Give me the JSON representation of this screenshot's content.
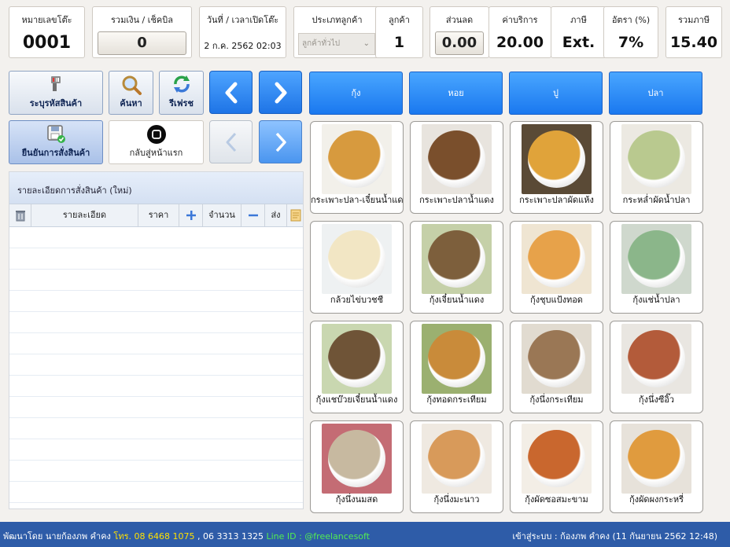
{
  "header": [
    {
      "label": "หมายเลขโต๊ะ",
      "value": "0001"
    },
    {
      "label": "รวมเงิน / เช็คบิล",
      "value": "0"
    },
    {
      "label": "วันที่ / เวลาเปิดโต๊ะ",
      "value": "2 ก.ค. 2562 02:03"
    },
    {
      "label": "ประเภทลูกค้า",
      "value": "ลูกค้าทั่วไป"
    },
    {
      "label": "ลูกค้า",
      "value": "1"
    },
    {
      "label": "ส่วนลด",
      "value": "0.00"
    },
    {
      "label": "ค่าบริการ",
      "value": "20.00"
    },
    {
      "label": "ภาษี",
      "value": "Ext."
    },
    {
      "label": "อัตรา (%)",
      "value": "7%"
    },
    {
      "label": "รวมภาษี",
      "value": "15.40"
    }
  ],
  "actions": {
    "barcode": "ระบุรหัสสินค้า",
    "search": "ค้นหา",
    "refresh": "รีเฟรช",
    "confirm": "ยืนยันการสั่งสินค้า",
    "home": "กลับสู่หน้าแรก"
  },
  "order": {
    "title": "รายละเอียดการสั่งสินค้า (ใหม่)",
    "columns": {
      "detail": "รายละเอียด",
      "price": "ราคา",
      "qty": "จำนวน",
      "send": "ส่ง"
    }
  },
  "categories": [
    "กุ้ง",
    "หอย",
    "ปู",
    "ปลา"
  ],
  "menu": [
    {
      "name": "กระเพาะปลา-เจี๋ยนน้ำแดง",
      "plate": "#d79a3e",
      "bg": "#f2f0ea"
    },
    {
      "name": "กระเพาะปลาน้ำแดง",
      "plate": "#7a4f2c",
      "bg": "#e8e4de"
    },
    {
      "name": "กระเพาะปลาผัดแห้ง",
      "plate": "#e0a33a",
      "bg": "#5a4a36"
    },
    {
      "name": "กระหล่ำผัดน้ำปลา",
      "plate": "#b9c98f",
      "bg": "#ece9e2"
    },
    {
      "name": "กล้วยไข่บวชชี",
      "plate": "#f2e6c4",
      "bg": "#eef1f2"
    },
    {
      "name": "กุ้งเจี๋ยนน้ำแดง",
      "plate": "#7d5f3c",
      "bg": "#c5d0a8"
    },
    {
      "name": "กุ้งชุบแป้งทอด",
      "plate": "#e7a24a",
      "bg": "#efe5d2"
    },
    {
      "name": "กุ้งแช่น้ำปลา",
      "plate": "#8bb68a",
      "bg": "#cfd8cd"
    },
    {
      "name": "กุ้งแชบ๊วยเจี๋ยนน้ำแดง",
      "plate": "#6f5437",
      "bg": "#c9d7b0"
    },
    {
      "name": "กุ้งทอดกระเทียม",
      "plate": "#c98b3a",
      "bg": "#9bb070"
    },
    {
      "name": "กุ้งนึ่งกระเทียม",
      "plate": "#9a7755",
      "bg": "#e1dbd0"
    },
    {
      "name": "กุ้งนึ่งซีอิ๊ว",
      "plate": "#b35b3a",
      "bg": "#e9e6e1"
    },
    {
      "name": "กุ้งนึ่งนมสด",
      "plate": "#c7b9a0",
      "bg": "#c46c74"
    },
    {
      "name": "กุ้งนึ่งมะนาว",
      "plate": "#d89a5a",
      "bg": "#efe9e1"
    },
    {
      "name": "กุ้งผัดซอสมะขาม",
      "plate": "#c9672e",
      "bg": "#f3eee6"
    },
    {
      "name": "กุ้งผัดผงกระหรี่",
      "plate": "#e09b3e",
      "bg": "#e7e2da"
    }
  ],
  "footer": {
    "dev": "พัฒนาโดย นายก้องภพ คำคง",
    "tel_label": "โทร.",
    "tel1": "08 6468 1075",
    "tel2": ", 06 3313 1325",
    "line": "Line ID : @freelancesoft",
    "login": "เข้าสู่ระบบ : ก้องภพ คำคง (11 กันยายน 2562 12:48)"
  },
  "colors": {
    "accent": "#1a78ef",
    "footer": "#2e5ca8"
  }
}
